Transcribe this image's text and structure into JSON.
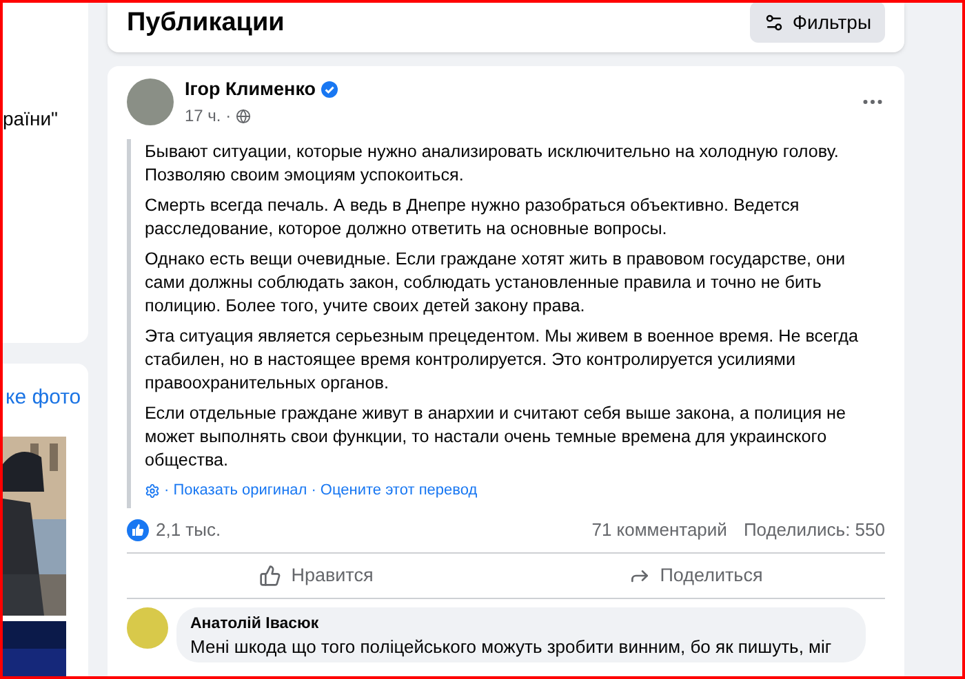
{
  "sidebar": {
    "top_card_text": "раїни\"",
    "photos_link": "ке фото"
  },
  "header": {
    "title": "Публикации",
    "filter_button": "Фильтры"
  },
  "post": {
    "author": "Ігор Клименко",
    "verified": true,
    "time": "17 ч. ·",
    "paragraphs": [
      "Бывают ситуации, которые нужно анализировать исключительно на холодную голову. Позволяю своим эмоциям успокоиться.",
      "Смерть всегда печаль. А ведь в Днепре нужно разобраться объективно. Ведется расследование, которое должно ответить на основные вопросы.",
      "Однако есть вещи очевидные. Если граждане хотят жить в правовом государстве, они сами должны соблюдать закон, соблюдать установленные правила и точно не бить полицию. Более того, учите своих детей закону права.",
      "Эта ситуация является серьезным прецедентом. Мы живем в военное время. Не всегда стабилен, но в настоящее время контролируется. Это контролируется усилиями правоохранительных органов.",
      "Если отдельные граждане живут в анархии и считают себя выше закона, а полиция не может выполнять свои функции, то настали очень темные времена для украинского общества."
    ],
    "translation_links": [
      "· Показать оригинал",
      "· Оцените этот перевод"
    ],
    "reactions": "2,1 тыс.",
    "comments_count": "71 комментарий",
    "shares": "Поделились: 550",
    "actions": [
      "Нравится",
      "Поделиться"
    ],
    "comment": {
      "author": "Анатолій Івасюк",
      "text": "Мені шкода що того поліцейського можуть зробити винним, бо як пишуть, міг"
    }
  }
}
